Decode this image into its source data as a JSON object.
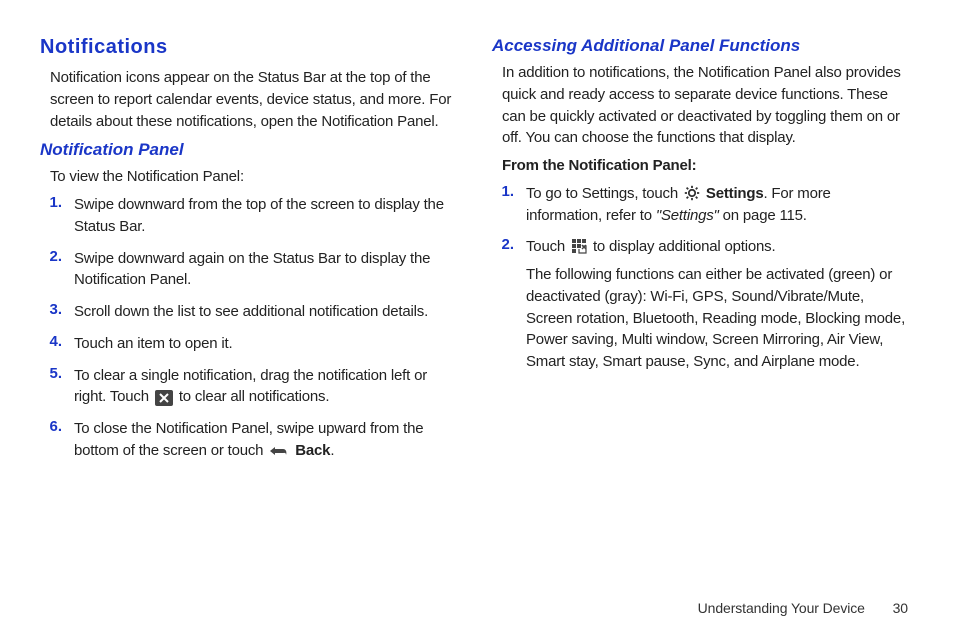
{
  "left": {
    "heading": "Notifications",
    "intro": "Notification icons appear on the Status Bar at the top of the screen to report calendar events, device status, and more. For details about these notifications, open the Notification Panel.",
    "subheading": "Notification Panel",
    "lead": "To view the Notification Panel:",
    "items": [
      {
        "num": "1.",
        "text": "Swipe downward from the top of the screen to display the Status Bar."
      },
      {
        "num": "2.",
        "text": "Swipe downward again on the Status Bar to display the Notification Panel."
      },
      {
        "num": "3.",
        "text": "Scroll down the list to see additional notification details."
      },
      {
        "num": "4.",
        "text": "Touch an item to open it."
      },
      {
        "num": "5.",
        "pre": "To clear a single notification, drag the notification left or right. Touch ",
        "post": " to clear all notifications."
      },
      {
        "num": "6.",
        "pre": "To close the Notification Panel, swipe upward from the bottom of the screen or touch ",
        "boldpost": "Back",
        "tail": "."
      }
    ]
  },
  "right": {
    "subheading": "Accessing Additional Panel Functions",
    "intro": "In addition to notifications, the Notification Panel also provides quick and ready access to separate device functions. These can be quickly activated or deactivated by toggling them on or off. You can choose the functions that display.",
    "lead": "From the Notification Panel:",
    "items": [
      {
        "num": "1.",
        "pre": "To go to Settings, touch ",
        "boldmid": "Settings",
        "mid2": ". For more information, refer to ",
        "ref": "\"Settings\"",
        "tail": " on page 115."
      },
      {
        "num": "2.",
        "pre": "Touch ",
        "post": " to display additional options.",
        "para2": "The following functions can either be activated (green) or deactivated (gray): Wi-Fi, GPS, Sound/Vibrate/Mute, Screen rotation, Bluetooth, Reading mode, Blocking mode, Power saving, Multi window, Screen Mirroring, Air View, Smart stay, Smart pause, Sync, and Airplane mode."
      }
    ]
  },
  "footer": {
    "text": "Understanding Your Device",
    "page": "30"
  }
}
